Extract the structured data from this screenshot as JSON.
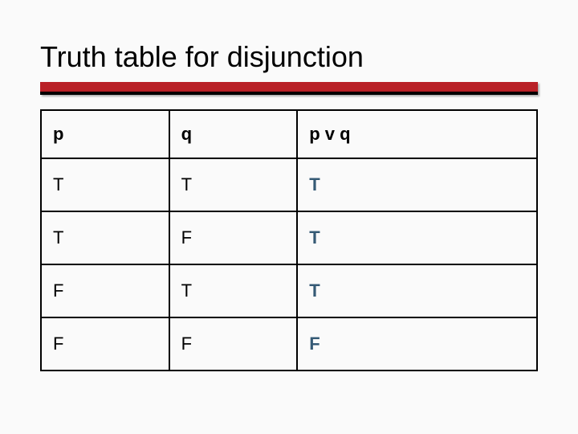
{
  "title": "Truth table for disjunction",
  "chart_data": {
    "type": "table",
    "columns": [
      "p",
      "q",
      "p v q"
    ],
    "rows": [
      [
        "T",
        "T",
        "T"
      ],
      [
        "T",
        "F",
        "T"
      ],
      [
        "F",
        "T",
        "T"
      ],
      [
        "F",
        "F",
        "F"
      ]
    ]
  }
}
